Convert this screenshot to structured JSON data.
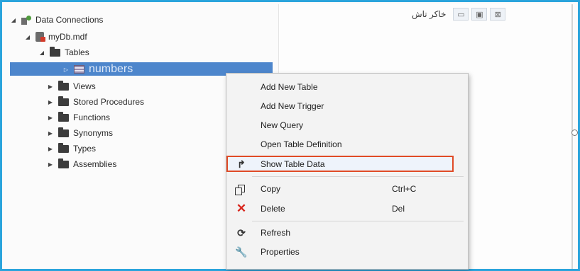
{
  "window": {
    "tab_title": "خاکر تاش",
    "tab_buttons": [
      "▭",
      "▣",
      "⊠"
    ]
  },
  "tree": {
    "root": "Data Connections",
    "database": "myDb.mdf",
    "tables": "Tables",
    "selected_table": "numbers",
    "other_folders": [
      "Views",
      "Stored Procedures",
      "Functions",
      "Synonyms",
      "Types",
      "Assemblies"
    ]
  },
  "context_menu": {
    "items": [
      {
        "label": "Add New Table",
        "shortcut": ""
      },
      {
        "label": "Add New Trigger",
        "shortcut": ""
      },
      {
        "label": "New Query",
        "shortcut": ""
      },
      {
        "label": "Open Table Definition",
        "shortcut": ""
      },
      {
        "label": "Show Table Data",
        "shortcut": ""
      },
      {
        "label": "Copy",
        "shortcut": "Ctrl+C"
      },
      {
        "label": "Delete",
        "shortcut": "Del"
      },
      {
        "label": "Refresh",
        "shortcut": ""
      },
      {
        "label": "Properties",
        "shortcut": ""
      }
    ]
  },
  "colors": {
    "frame_border": "#2aa4dc",
    "selection": "#4d86cc",
    "highlight_box": "#e04a26",
    "delete_icon": "#d8261c"
  }
}
